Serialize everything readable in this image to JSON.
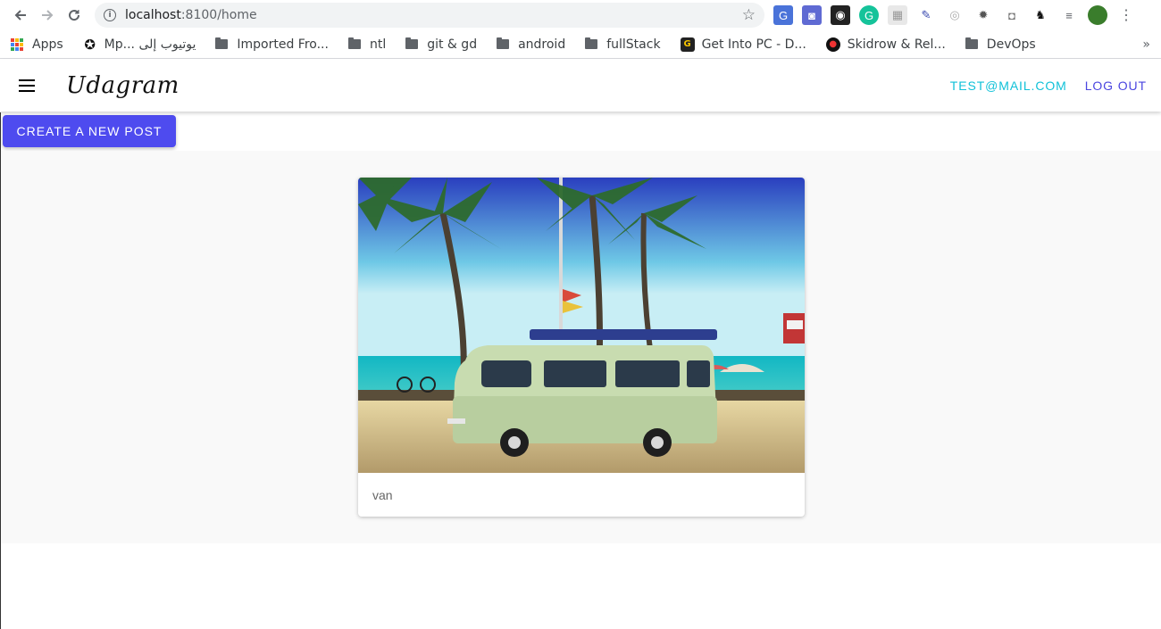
{
  "browser": {
    "url_host": "localhost",
    "url_path": ":8100/home",
    "bookmarks": [
      {
        "label": "Apps",
        "kind": "apps"
      },
      {
        "label": "Mp... يوتيوب إلى",
        "kind": "site"
      },
      {
        "label": "Imported Fro...",
        "kind": "folder"
      },
      {
        "label": "ntl",
        "kind": "folder"
      },
      {
        "label": "git & gd",
        "kind": "folder"
      },
      {
        "label": "android",
        "kind": "folder"
      },
      {
        "label": "fullStack",
        "kind": "folder"
      },
      {
        "label": "Get Into PC - D...",
        "kind": "site"
      },
      {
        "label": "Skidrow & Rel...",
        "kind": "site"
      },
      {
        "label": "DevOps",
        "kind": "folder"
      }
    ],
    "more": "»"
  },
  "header": {
    "brand": "Udagram",
    "user_email": "TEST@MAIL.COM",
    "logout_label": "LOG OUT"
  },
  "actions": {
    "create_label": "CREATE A NEW POST"
  },
  "feed": {
    "items": [
      {
        "caption": "van"
      }
    ]
  },
  "colors": {
    "accent": "#4e4bef",
    "email": "#10c1d8",
    "logout": "#4b46e0"
  }
}
